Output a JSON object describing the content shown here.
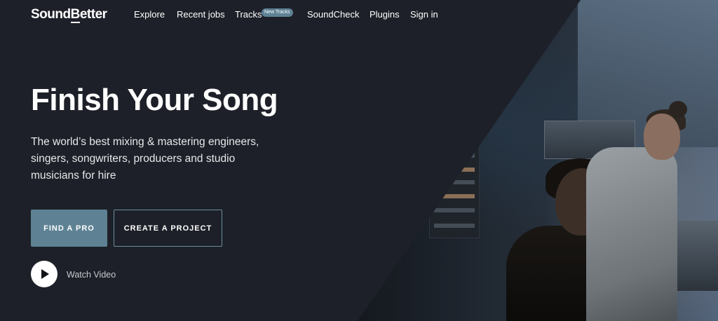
{
  "brand": {
    "logo_pre": "Sound",
    "logo_mid": "B",
    "logo_post": "etter"
  },
  "nav": {
    "explore": "Explore",
    "recent_jobs": "Recent jobs",
    "tracks": "Tracks",
    "tracks_badge": "New Tracks",
    "soundcheck": "SoundCheck",
    "plugins": "Plugins",
    "sign_in": "Sign in"
  },
  "hero": {
    "title": "Finish Your Song",
    "subtitle": "The world’s best mixing & mastering engineers, singers, songwriters, producers and studio musicians for hire",
    "find_pro": "FIND A PRO",
    "create_project": "CREATE A PROJECT",
    "watch_video": "Watch Video"
  },
  "colors": {
    "background": "#1d2028",
    "accent": "#5e8294",
    "badge": "#5f8295"
  },
  "icons": {
    "play": "play-icon"
  }
}
